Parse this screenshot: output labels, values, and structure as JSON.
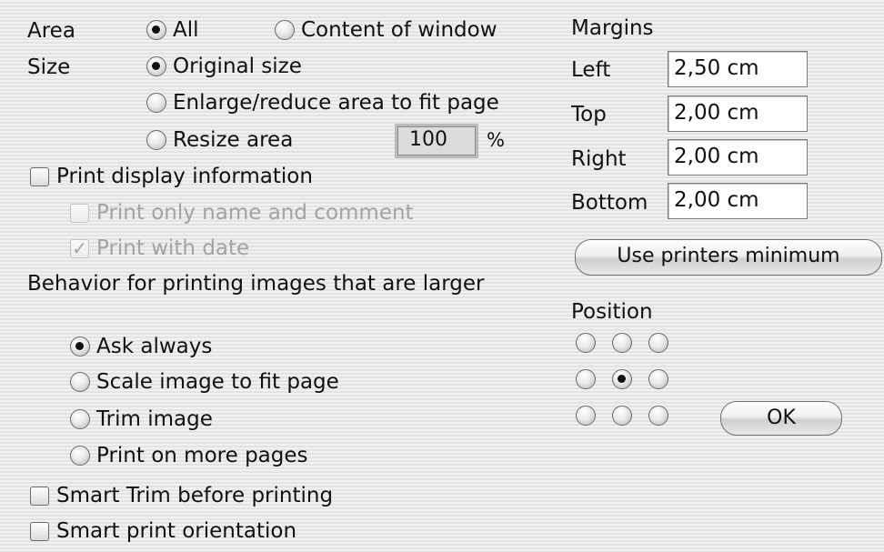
{
  "area": {
    "label": "Area",
    "options": [
      "All",
      "Content of window"
    ],
    "selected": "All"
  },
  "size": {
    "label": "Size",
    "options": [
      "Original size",
      "Enlarge/reduce area to fit page",
      "Resize area"
    ],
    "selected": "Original size",
    "resize_value": "100",
    "resize_unit": "%"
  },
  "display_info": {
    "label": "Print display information",
    "checked": false,
    "sub_name_comment": {
      "label": "Print only name and comment",
      "checked": false,
      "enabled": false
    },
    "sub_date": {
      "label": "Print with date",
      "checked": true,
      "enabled": false
    }
  },
  "large_images": {
    "label": "Behavior for printing images that are larger",
    "options": [
      "Ask always",
      "Scale image to fit page",
      "Trim image",
      "Print on more pages"
    ],
    "selected": "Ask always"
  },
  "smart_trim": {
    "label": "Smart Trim before printing",
    "checked": false
  },
  "smart_orientation": {
    "label": "Smart print orientation",
    "checked": false
  },
  "margins": {
    "title": "Margins",
    "left": {
      "label": "Left",
      "value": "2,50 cm"
    },
    "top": {
      "label": "Top",
      "value": "2,00 cm"
    },
    "right": {
      "label": "Right",
      "value": "2,00 cm"
    },
    "bottom": {
      "label": "Bottom",
      "value": "2,00 cm"
    },
    "use_minimum_label": "Use printers minimum"
  },
  "position": {
    "title": "Position",
    "grid": [
      "top-left",
      "top-center",
      "top-right",
      "middle-left",
      "center",
      "middle-right",
      "bottom-left",
      "bottom-center",
      "bottom-right"
    ],
    "selected": "center"
  },
  "ok_label": "OK"
}
